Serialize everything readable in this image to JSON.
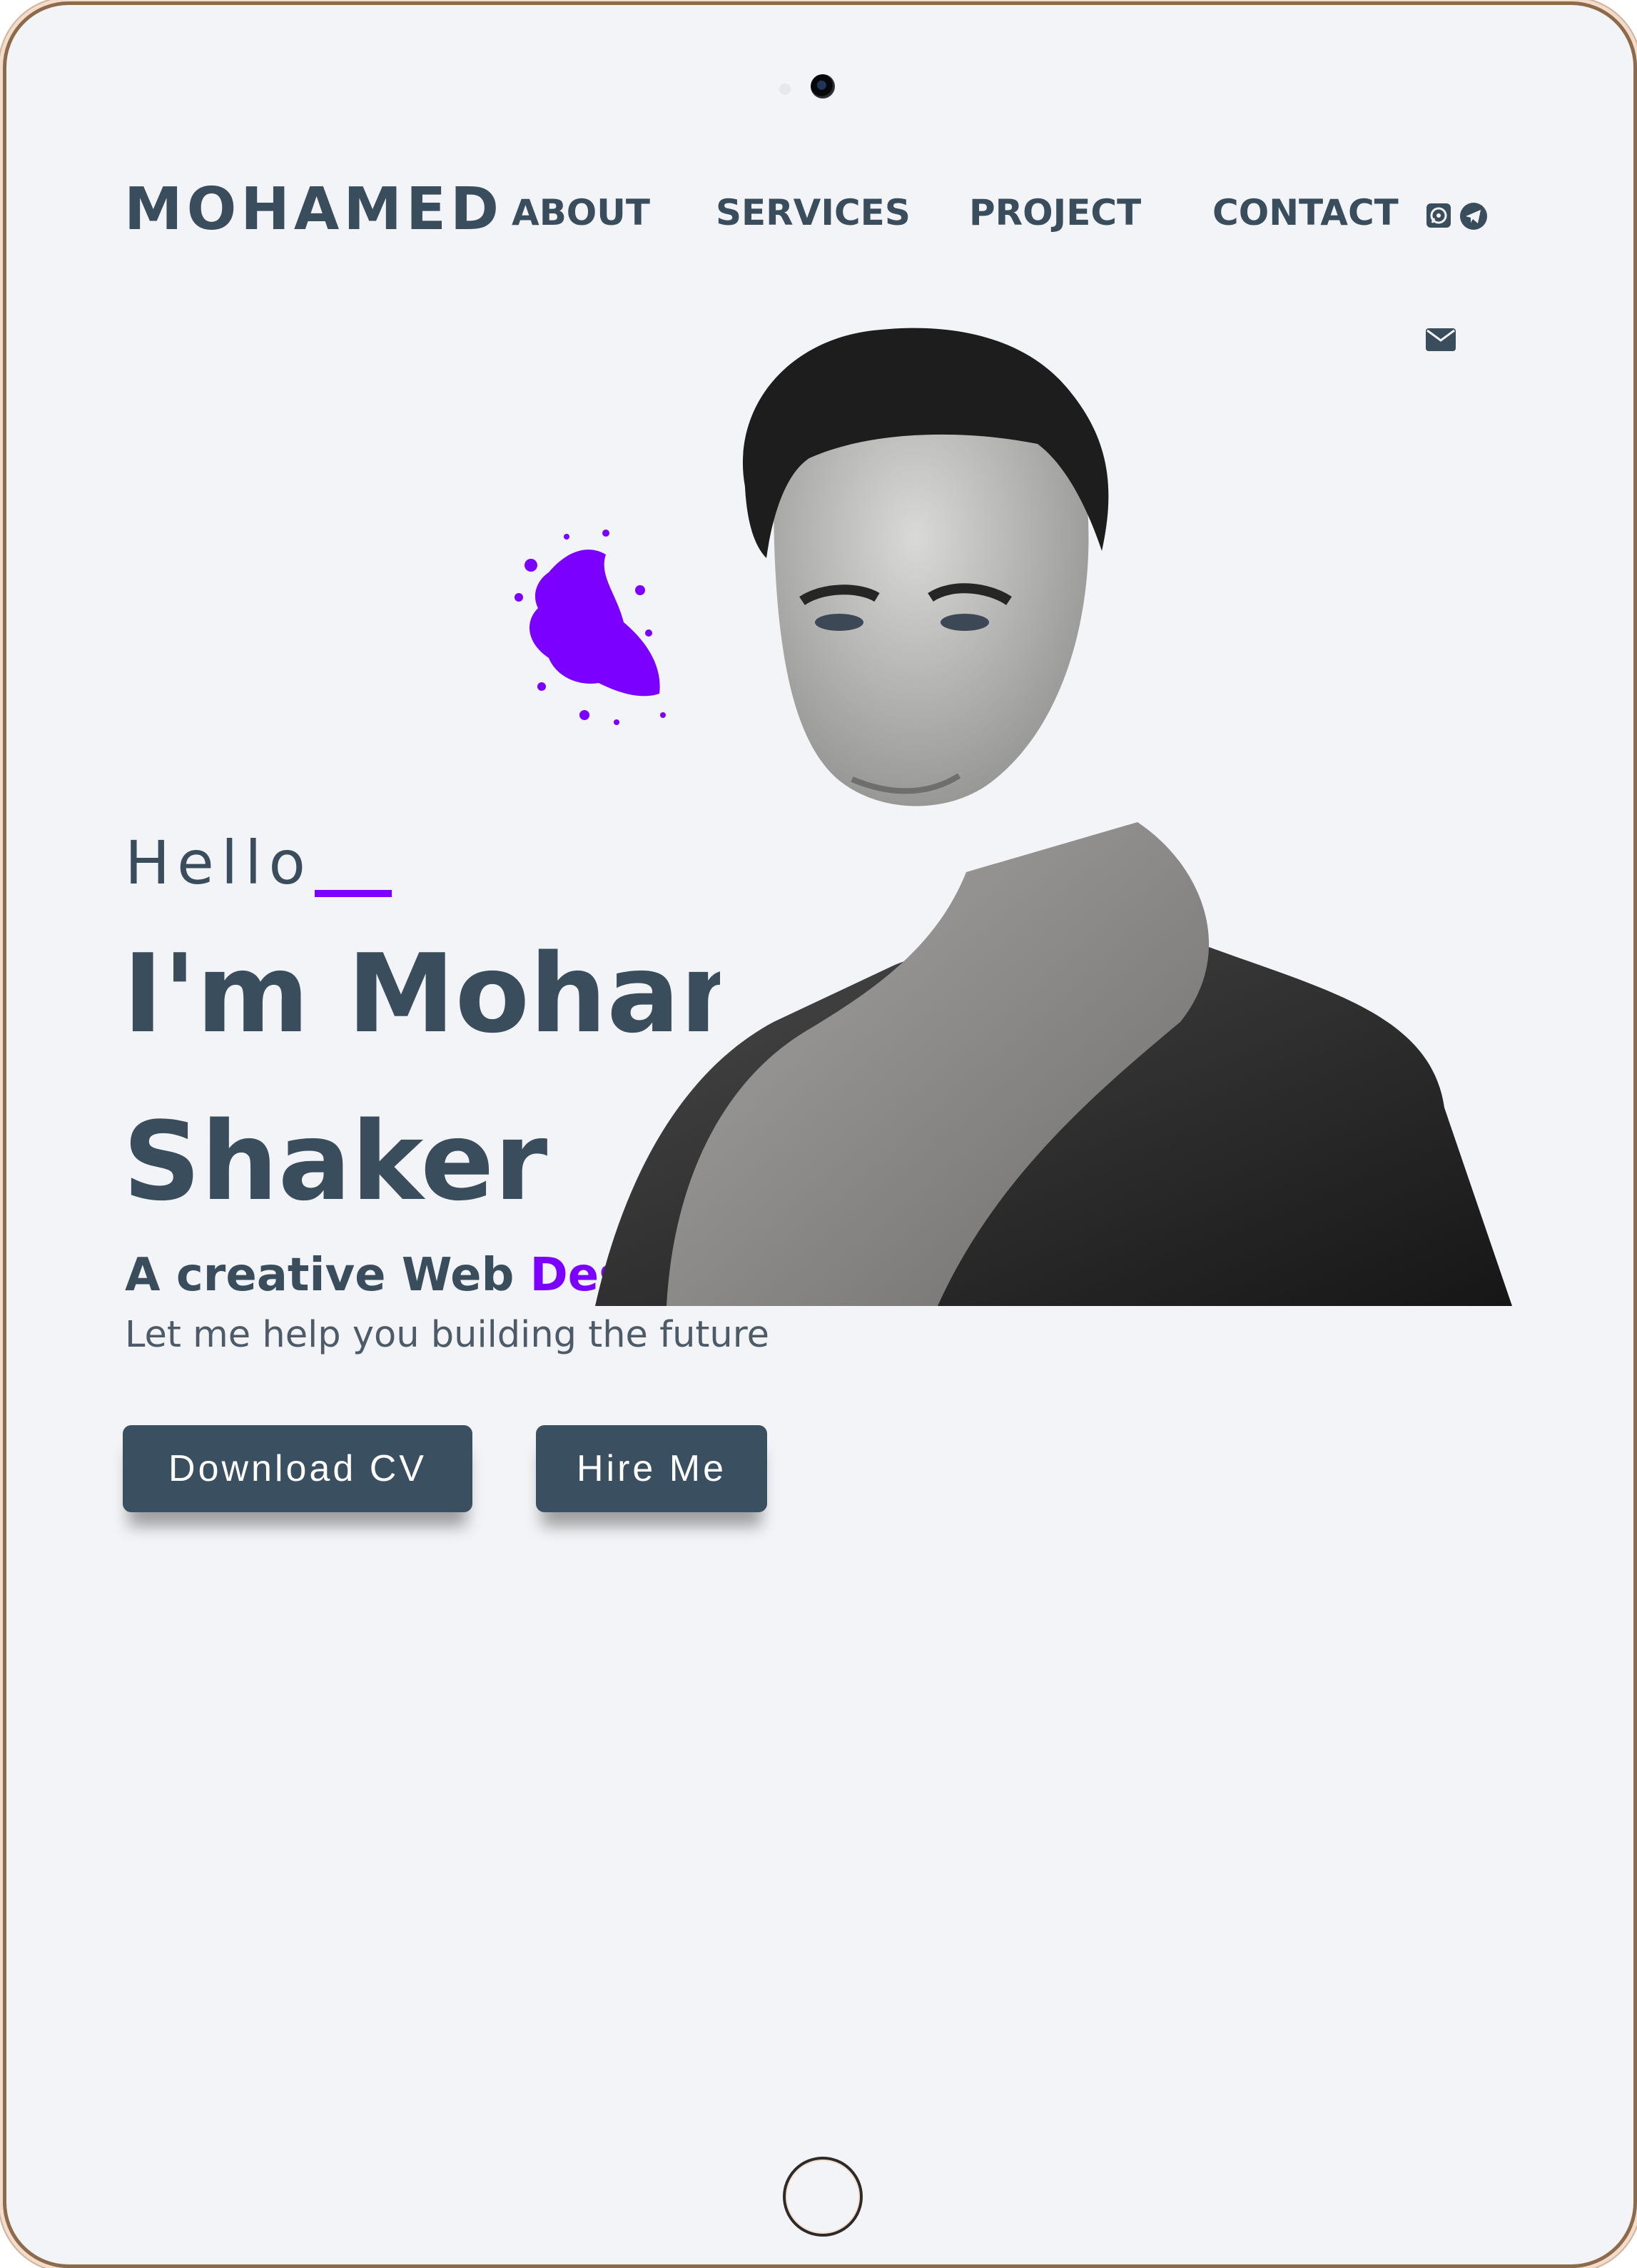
{
  "nav": {
    "brand": "MOHAMED",
    "links": [
      "ABOUT",
      "SERVICES",
      "PROJECT",
      "CONTACT"
    ],
    "social_icons": [
      "whatsapp-icon",
      "telegram-icon",
      "envelope-icon"
    ]
  },
  "hero": {
    "greeting": "Hello",
    "headline_line1": "I'm Mohamed",
    "headline_line2": "Shaker",
    "tagline_prefix": "A creative Web ",
    "tagline_accent": "Designer",
    "subtitle": "Let me help you building the future",
    "buttons": {
      "download": "Download CV",
      "hire": "Hire Me"
    }
  },
  "colors": {
    "accent": "#7b00ff",
    "text": "#3a4d5c",
    "button": "#3a4f5f",
    "background": "#f3f4f7"
  }
}
